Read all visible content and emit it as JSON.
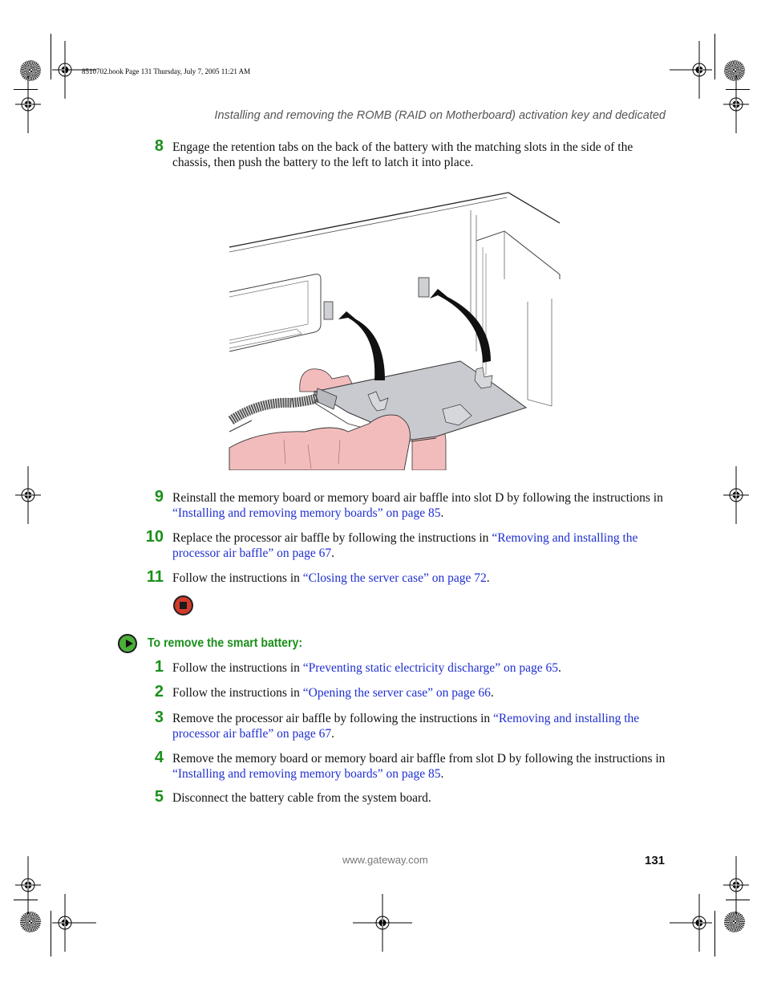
{
  "slug": "8510702.book  Page 131  Thursday, July 7, 2005  11:21 AM",
  "running_head": "Installing and removing the ROMB (RAID on Motherboard) activation key and dedicated",
  "steps_a": [
    {
      "num": "8",
      "text": "Engage the retention tabs on the back of the battery with the matching slots in the side of the chassis, then push the battery to the left to latch it into place.",
      "link": "",
      "after": ""
    },
    {
      "num": "9",
      "text": "Reinstall the memory board or memory board air baffle into slot D by following the instructions in ",
      "link": "“Installing and removing memory boards” on page 85",
      "after": "."
    },
    {
      "num": "10",
      "text": "Replace the processor air baffle by following the instructions in ",
      "link": "“Removing and installing the processor air baffle” on page 67",
      "after": "."
    },
    {
      "num": "11",
      "text": "Follow the instructions in ",
      "link": "“Closing the server case” on page 72",
      "after": "."
    }
  ],
  "figure": {
    "description": "Hand inserting smart battery into chassis slots with arrows showing tab engagement",
    "colors": {
      "battery": "#c8cacf",
      "hand": "#f3bcbc",
      "arrow": "#111111"
    }
  },
  "end_icon": "stop-icon",
  "section": {
    "icon": "play-icon",
    "title": "To remove the smart battery:"
  },
  "steps_b": [
    {
      "num": "1",
      "text": "Follow the instructions in ",
      "link": "“Preventing static electricity discharge” on page 65",
      "after": "."
    },
    {
      "num": "2",
      "text": "Follow the instructions in ",
      "link": "“Opening the server case” on page 66",
      "after": "."
    },
    {
      "num": "3",
      "text": "Remove the processor air baffle by following the instructions in ",
      "link": "“Removing and installing the processor air baffle” on page 67",
      "after": "."
    },
    {
      "num": "4",
      "text": "Remove the memory board or memory board air baffle from slot D by following the instructions in ",
      "link": "“Installing and removing memory boards” on page 85",
      "after": "."
    },
    {
      "num": "5",
      "text": "Disconnect the battery cable from the system board.",
      "link": "",
      "after": ""
    }
  ],
  "footer": {
    "url": "www.gateway.com",
    "page_number": "131"
  },
  "colors": {
    "step_number": "#1a8f1a",
    "link": "#1f2fd0",
    "running_head": "#555555"
  }
}
